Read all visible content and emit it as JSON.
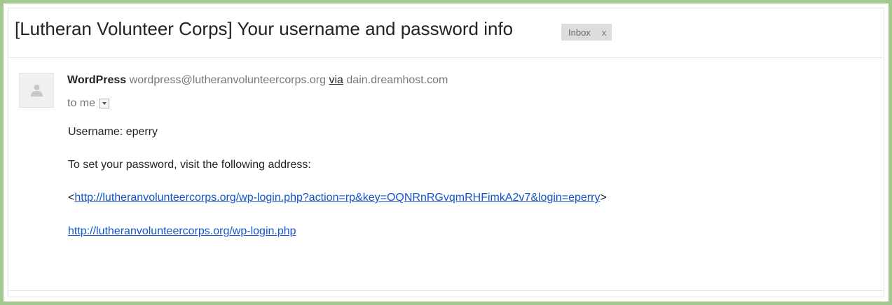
{
  "email": {
    "subject": "[Lutheran Volunteer Corps] Your username and password info",
    "label": {
      "text": "Inbox",
      "remove": "x"
    },
    "sender": {
      "name": "WordPress",
      "address": "wordpress@lutheranvolunteercorps.org",
      "via_label": "via",
      "via_host": "dain.dreamhost.com"
    },
    "recipient_text": "to me",
    "avatar_icon": "person-icon",
    "body": {
      "username_line": "Username: eperry",
      "instruction_line": "To set your password, visit the following address:",
      "reset_link_open": "<",
      "reset_link": "http://lutheranvolunteercorps.org/wp-login.php?action=rp&key=OQNRnRGvqmRHFimkA2v7&login=eperry",
      "reset_link_close": ">",
      "login_link": "http://lutheranvolunteercorps.org/wp-login.php"
    }
  },
  "colors": {
    "frame_border": "#a3c98f",
    "link": "#1155cc",
    "label_chip": "#dddddd"
  }
}
